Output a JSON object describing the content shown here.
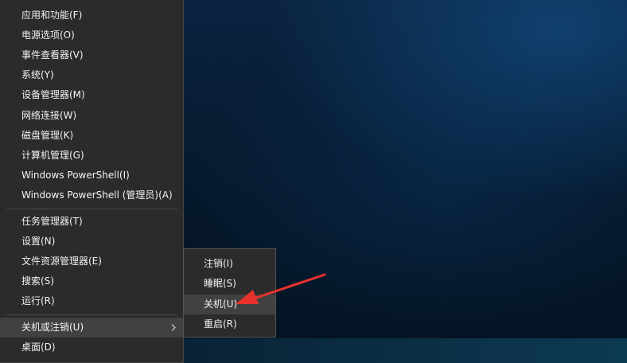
{
  "desktop": {
    "wallpaper_colors": [
      "#0b2440",
      "#06182c",
      "#1458a0"
    ]
  },
  "main_menu": {
    "group1": [
      {
        "label": "应用和功能(F)"
      },
      {
        "label": "电源选项(O)"
      },
      {
        "label": "事件查看器(V)"
      },
      {
        "label": "系统(Y)"
      },
      {
        "label": "设备管理器(M)"
      },
      {
        "label": "网络连接(W)"
      },
      {
        "label": "磁盘管理(K)"
      },
      {
        "label": "计算机管理(G)"
      },
      {
        "label": "Windows PowerShell(I)"
      },
      {
        "label": "Windows PowerShell (管理员)(A)"
      }
    ],
    "group2": [
      {
        "label": "任务管理器(T)"
      },
      {
        "label": "设置(N)"
      },
      {
        "label": "文件资源管理器(E)"
      },
      {
        "label": "搜索(S)"
      },
      {
        "label": "运行(R)"
      }
    ],
    "shutdown_item": {
      "label": "关机或注销(U)",
      "icon": "chevron-right-icon"
    },
    "desktop_item": {
      "label": "桌面(D)"
    }
  },
  "sub_menu": {
    "items": [
      {
        "label": "注销(I)"
      },
      {
        "label": "睡眠(S)"
      },
      {
        "label": "关机(U)"
      },
      {
        "label": "重启(R)"
      }
    ]
  },
  "annotation": {
    "arrow_color": "#e8322c",
    "points_to": "关机(U)"
  },
  "colors": {
    "menu_bg": "#2b2b2b",
    "menu_highlight": "#414141",
    "menu_text": "#f2f2f2"
  }
}
